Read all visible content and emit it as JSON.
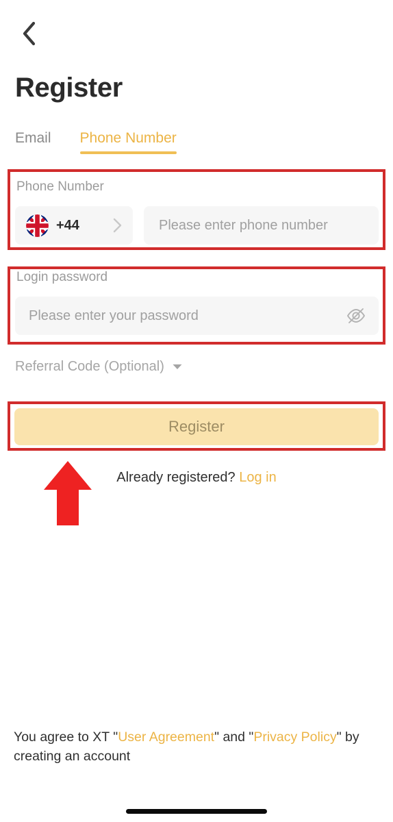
{
  "header": {
    "back_icon": "chevron-left-icon",
    "title": "Register"
  },
  "tabs": [
    {
      "label": "Email",
      "active": false
    },
    {
      "label": "Phone Number",
      "active": true
    }
  ],
  "phone_field": {
    "label": "Phone Number",
    "country": {
      "flag_icon": "uk-flag-icon",
      "dial_code": "+44",
      "chevron_icon": "chevron-right-icon"
    },
    "placeholder": "Please enter phone number",
    "value": ""
  },
  "password_field": {
    "label": "Login password",
    "placeholder": "Please enter your password",
    "value": "",
    "toggle_icon": "eye-off-icon"
  },
  "referral": {
    "label": "Referral Code (Optional)",
    "caret_icon": "caret-down-icon"
  },
  "register_button": {
    "label": "Register"
  },
  "already_registered": {
    "text": "Already registered?",
    "link_label": "Log in"
  },
  "agreement": {
    "prefix": "You agree to XT \"",
    "link1": "User Agreement",
    "middle": "\" and \"",
    "link2": "Privacy Policy",
    "suffix": "\" by creating an account"
  },
  "annotations": {
    "box_color": "#d12c2c",
    "arrow_color": "#ee2222",
    "arrow_points_to": "register-button"
  },
  "colors": {
    "accent": "#ecb445",
    "tab_underline": "#f0bf55",
    "button_bg": "#fae3ad",
    "button_text": "#9d8c63",
    "field_bg": "#f6f6f6",
    "placeholder": "#a0a0a0",
    "title": "#2b2b2b"
  }
}
